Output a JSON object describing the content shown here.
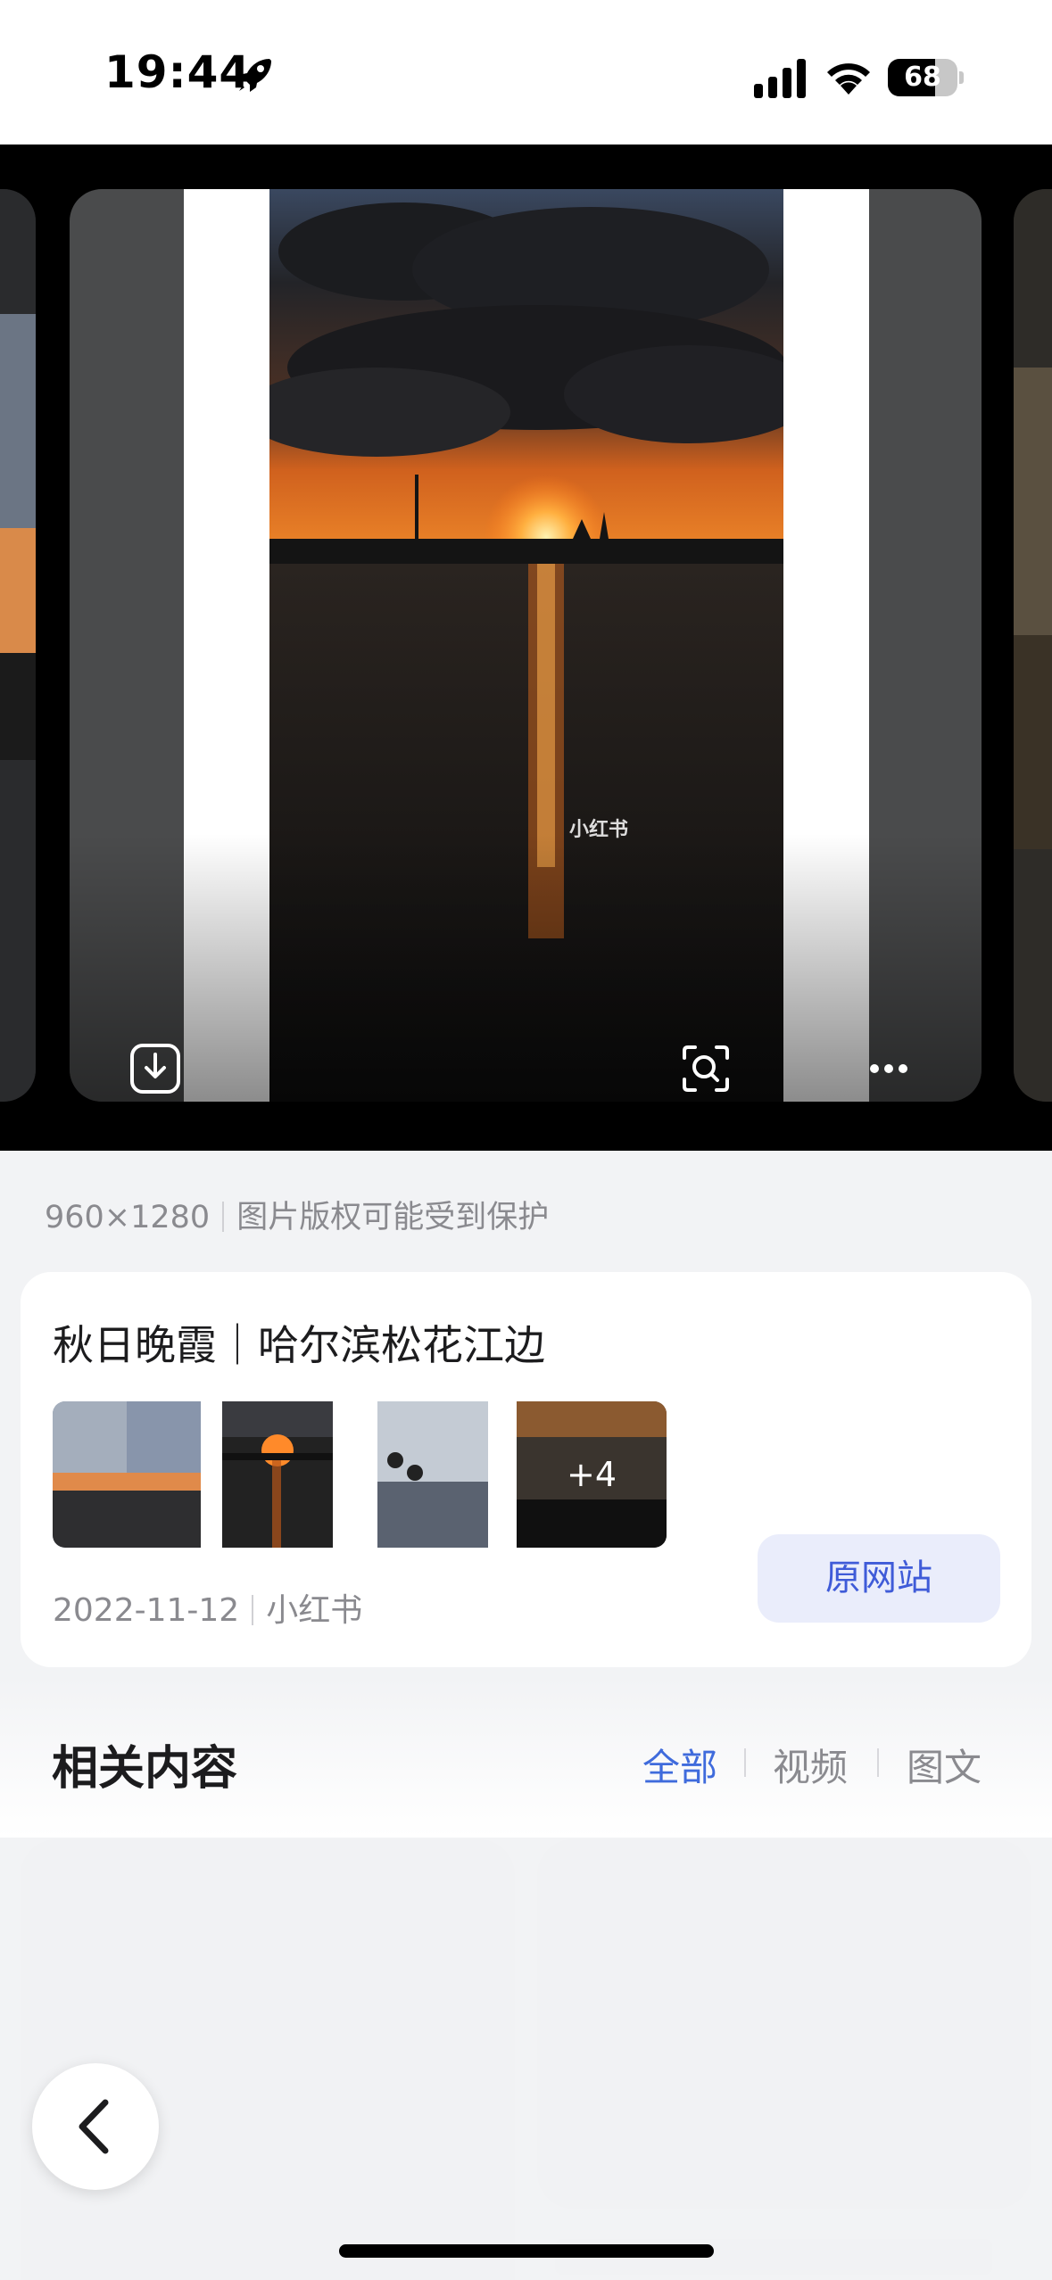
{
  "status_bar": {
    "time": "19:44",
    "battery": "68",
    "battery_level": 0.68,
    "icons": [
      "rocket-icon",
      "cellular-signal-icon",
      "wifi-icon",
      "battery-icon"
    ]
  },
  "gallery": {
    "watermark": "小红书",
    "actions": [
      "download-icon",
      "lens-search-icon",
      "more-icon"
    ]
  },
  "image_meta": {
    "dimensions": "960×1280",
    "copyright_note": "图片版权可能受到保护"
  },
  "source_card": {
    "title": "秋日晚霞｜哈尔滨松花江边",
    "more_count": "+4",
    "date": "2022-11-12",
    "platform": "小红书",
    "button_label": "原网站"
  },
  "related": {
    "title": "相关内容",
    "filters": [
      "全部",
      "视频",
      "图文"
    ],
    "active_filter": "全部"
  },
  "colors": {
    "accent": "#3f5bd8",
    "page_bg": "#f2f3f5"
  },
  "nav": {
    "back_icon": "chevron-left-icon"
  }
}
